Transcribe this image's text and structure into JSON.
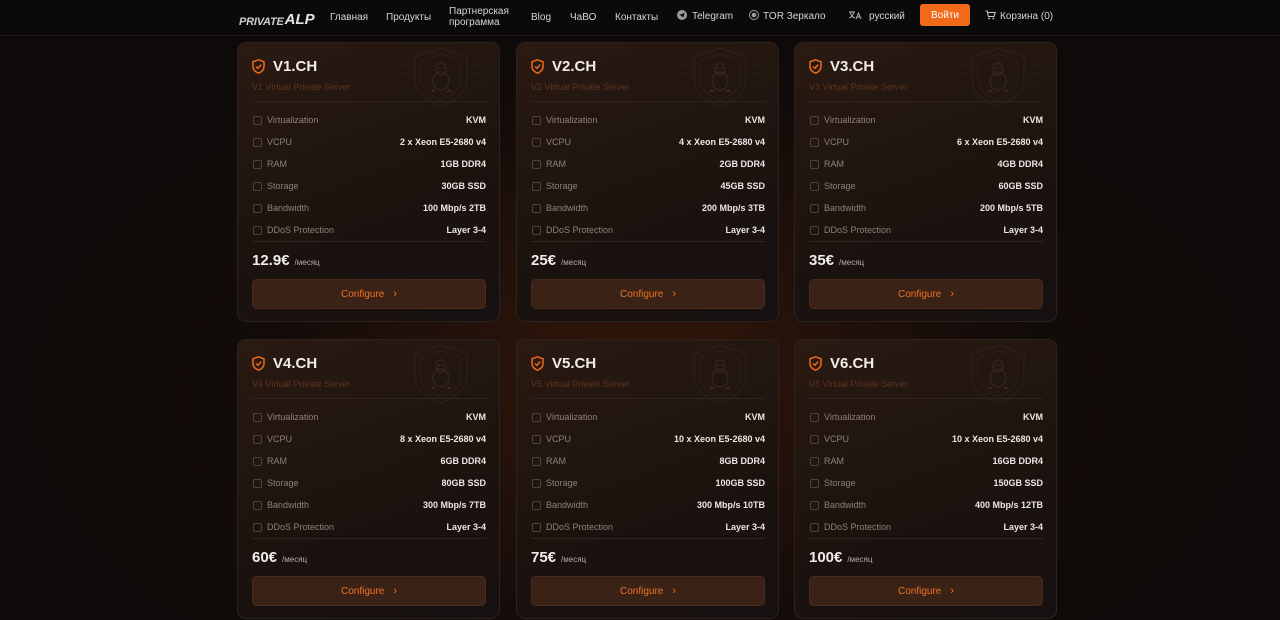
{
  "header": {
    "logo_text": "PRIVATE",
    "logo_mark": "ALP",
    "nav": [
      {
        "label": "Главная"
      },
      {
        "label": "Продукты"
      },
      {
        "label": "Партнерская программа",
        "line1": "Партнерская",
        "line2": "программа"
      },
      {
        "label": "Blog"
      },
      {
        "label": "ЧаВО"
      },
      {
        "label": "Контакты"
      },
      {
        "label": "Telegram",
        "icon": "telegram-icon"
      },
      {
        "label": "TOR Зеркало",
        "icon": "tor-icon"
      },
      {
        "label": "русский",
        "icon": "language-icon"
      }
    ],
    "login_label": "Войти",
    "cart_label": "Корзина (0)"
  },
  "spec_labels": [
    "Virtualization",
    "VCPU",
    "RAM",
    "Storage",
    "Bandwidth",
    "DDoS Protection"
  ],
  "configure_label": "Configure",
  "period_label": "/месяц",
  "accent_color": "#f06a1a",
  "plans": [
    {
      "name": "V1.CH",
      "subtitle": "V1 Virtual Private Server",
      "price": "12.9€",
      "specs": [
        "KVM",
        "2 x Xeon E5-2680 v4",
        "1GB DDR4",
        "30GB SSD",
        "100 Mbp/s 2TB",
        "Layer 3-4"
      ]
    },
    {
      "name": "V2.CH",
      "subtitle": "V2 Virtual Private Server",
      "price": "25€",
      "specs": [
        "KVM",
        "4 x Xeon E5-2680 v4",
        "2GB DDR4",
        "45GB SSD",
        "200 Mbp/s 3TB",
        "Layer 3-4"
      ]
    },
    {
      "name": "V3.CH",
      "subtitle": "V3 Virtual Private Server",
      "price": "35€",
      "specs": [
        "KVM",
        "6 x Xeon E5-2680 v4",
        "4GB DDR4",
        "60GB SSD",
        "200 Mbp/s 5TB",
        "Layer 3-4"
      ]
    },
    {
      "name": "V4.CH",
      "subtitle": "V4 Virtual Private Server",
      "price": "60€",
      "specs": [
        "KVM",
        "8 x Xeon E5-2680 v4",
        "6GB DDR4",
        "80GB SSD",
        "300 Mbp/s 7TB",
        "Layer 3-4"
      ]
    },
    {
      "name": "V5.CH",
      "subtitle": "V5 Virtual Private Server",
      "price": "75€",
      "specs": [
        "KVM",
        "10 x Xeon E5-2680 v4",
        "8GB DDR4",
        "100GB SSD",
        "300 Mbp/s 10TB",
        "Layer 3-4"
      ]
    },
    {
      "name": "V6.CH",
      "subtitle": "V6 Virtual Private Server",
      "price": "100€",
      "specs": [
        "KVM",
        "10 x Xeon E5-2680 v4",
        "16GB DDR4",
        "150GB SSD",
        "400 Mbp/s 12TB",
        "Layer 3-4"
      ]
    }
  ]
}
